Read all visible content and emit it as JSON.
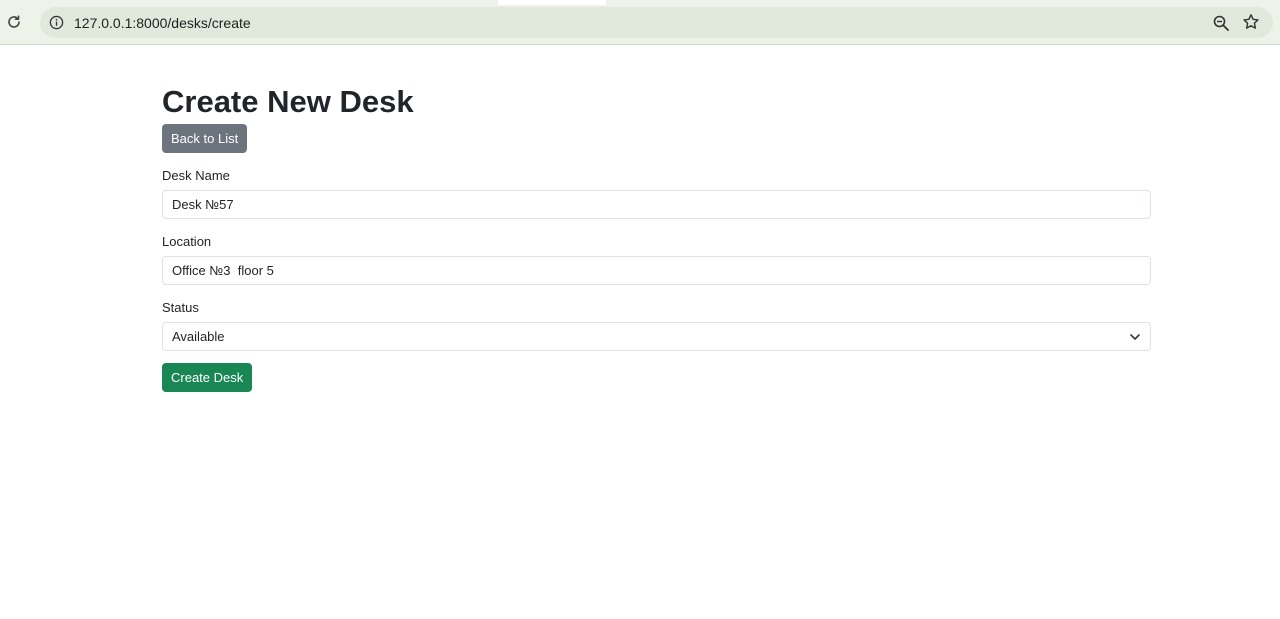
{
  "browser": {
    "url": "127.0.0.1:8000/desks/create",
    "icons": [
      "reload-icon",
      "info-icon",
      "zoom-icon",
      "star-icon"
    ]
  },
  "page": {
    "title": "Create New Desk",
    "back_button": "Back to List",
    "form": {
      "desk_name": {
        "label": "Desk Name",
        "value": "Desk №57"
      },
      "location": {
        "label": "Location",
        "value": "Office №3  floor 5"
      },
      "status": {
        "label": "Status",
        "value": "Available"
      },
      "submit_label": "Create Desk"
    }
  },
  "colors": {
    "secondary_button": "#6c757d",
    "success_button": "#198754",
    "browser_bar": "#eef3ea",
    "omnibox": "#e1e9dc"
  }
}
